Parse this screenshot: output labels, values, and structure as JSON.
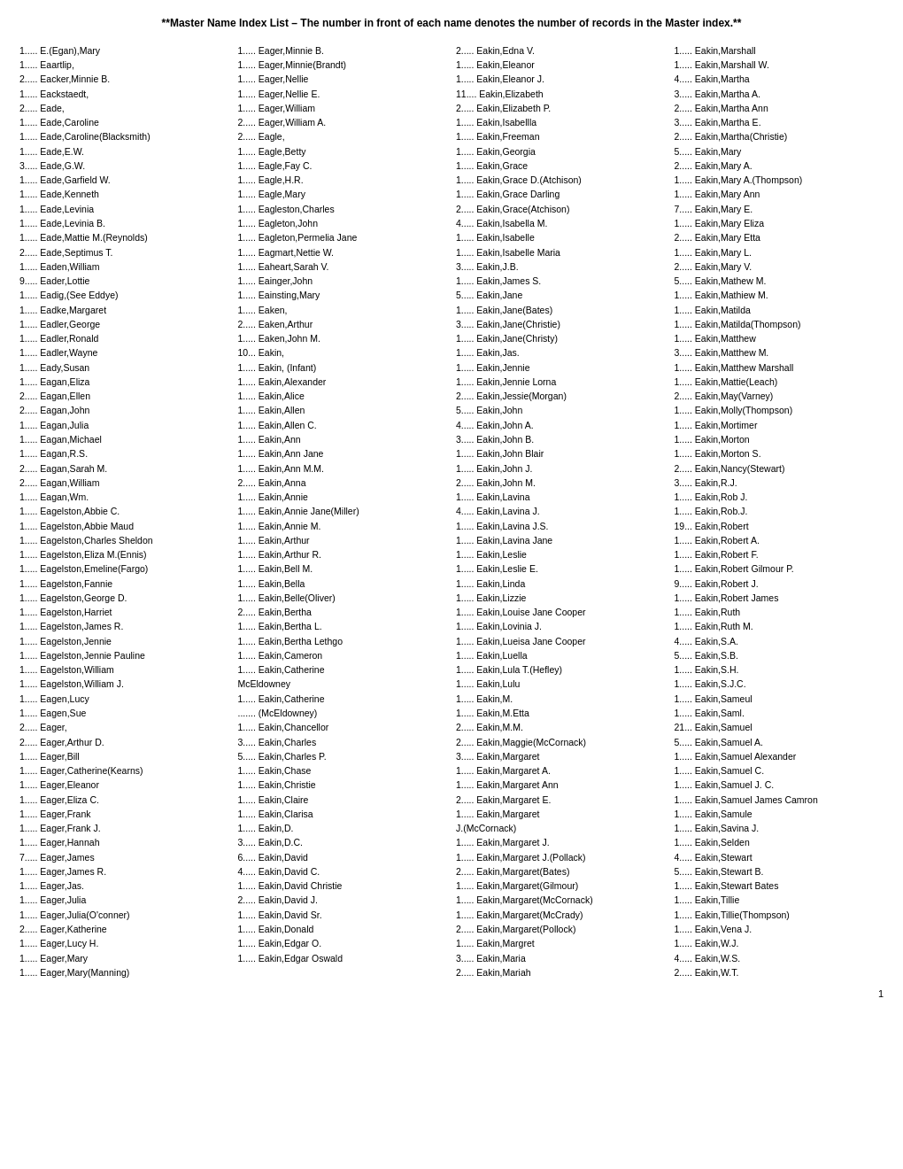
{
  "title": "**Master Name Index List – The number in front of each name denotes the number of records in the Master index.**",
  "page_number": "1",
  "columns": [
    {
      "entries": [
        "1..... E.(Egan),Mary",
        "1..... Eaartlip,",
        "2..... Eacker,Minnie B.",
        "1..... Eackstaedt,",
        "2..... Eade,",
        "1..... Eade,Caroline",
        "1..... Eade,Caroline(Blacksmith)",
        "1..... Eade,E.W.",
        "3..... Eade,G.W.",
        "1..... Eade,Garfield W.",
        "1..... Eade,Kenneth",
        "1..... Eade,Levinia",
        "1..... Eade,Levinia B.",
        "1..... Eade,Mattie M.(Reynolds)",
        "2..... Eade,Septimus T.",
        "1..... Eaden,William",
        "9..... Eader,Lottie",
        "1..... Eadig,(See Eddye)",
        "1..... Eadke,Margaret",
        "1..... Eadler,George",
        "1..... Eadler,Ronald",
        "1..... Eadler,Wayne",
        "1..... Eady,Susan",
        "1..... Eagan,Eliza",
        "2..... Eagan,Ellen",
        "2..... Eagan,John",
        "1..... Eagan,Julia",
        "1..... Eagan,Michael",
        "1..... Eagan,R.S.",
        "2..... Eagan,Sarah M.",
        "2..... Eagan,William",
        "1..... Eagan,Wm.",
        "1..... Eagelston,Abbie C.",
        "1..... Eagelston,Abbie Maud",
        "1..... Eagelston,Charles Sheldon",
        "1..... Eagelston,Eliza M.(Ennis)",
        "1..... Eagelston,Emeline(Fargo)",
        "1..... Eagelston,Fannie",
        "1..... Eagelston,George D.",
        "1..... Eagelston,Harriet",
        "1..... Eagelston,James R.",
        "1..... Eagelston,Jennie",
        "1..... Eagelston,Jennie Pauline",
        "1..... Eagelston,William",
        "1..... Eagelston,William J.",
        "1..... Eagen,Lucy",
        "1..... Eagen,Sue",
        "2..... Eager,",
        "2..... Eager,Arthur D.",
        "1..... Eager,Bill",
        "1..... Eager,Catherine(Kearns)",
        "1..... Eager,Eleanor",
        "1..... Eager,Eliza C.",
        "1..... Eager,Frank",
        "1..... Eager,Frank J.",
        "1..... Eager,Hannah",
        "7..... Eager,James",
        "1..... Eager,James R.",
        "1..... Eager,Jas.",
        "1..... Eager,Julia",
        "1..... Eager,Julia(O'conner)",
        "2..... Eager,Katherine",
        "1..... Eager,Lucy H.",
        "1..... Eager,Mary",
        "1..... Eager,Mary(Manning)"
      ]
    },
    {
      "entries": [
        "1..... Eager,Minnie B.",
        "1..... Eager,Minnie(Brandt)",
        "1..... Eager,Nellie",
        "1..... Eager,Nellie E.",
        "1..... Eager,William",
        "2..... Eager,William A.",
        "2..... Eagle,",
        "1..... Eagle,Betty",
        "1..... Eagle,Fay C.",
        "1..... Eagle,H.R.",
        "1..... Eagle,Mary",
        "1..... Eagleston,Charles",
        "1..... Eagleton,John",
        "1..... Eagleton,Permelia Jane",
        "1..... Eagmart,Nettie W.",
        "1..... Eaheart,Sarah V.",
        "1..... Eainger,John",
        "1..... Eainsting,Mary",
        "1..... Eaken,",
        "2..... Eaken,Arthur",
        "1..... Eaken,John M.",
        "10... Eakin,",
        "1..... Eakin, (Infant)",
        "1..... Eakin,Alexander",
        "1..... Eakin,Alice",
        "1..... Eakin,Allen",
        "1..... Eakin,Allen C.",
        "1..... Eakin,Ann",
        "1..... Eakin,Ann Jane",
        "1..... Eakin,Ann M.M.",
        "2..... Eakin,Anna",
        "1..... Eakin,Annie",
        "1..... Eakin,Annie Jane(Miller)",
        "1..... Eakin,Annie M.",
        "1..... Eakin,Arthur",
        "1..... Eakin,Arthur R.",
        "1..... Eakin,Bell M.",
        "1..... Eakin,Bella",
        "1..... Eakin,Belle(Oliver)",
        "2..... Eakin,Bertha",
        "1..... Eakin,Bertha L.",
        "1..... Eakin,Bertha Lethgo",
        "1..... Eakin,Cameron",
        "1..... Eakin,Catherine",
        "       McEldowney",
        "1..... Eakin,Catherine",
        "....... (McEldowney)",
        "1..... Eakin,Chancellor",
        "3..... Eakin,Charles",
        "5..... Eakin,Charles P.",
        "1..... Eakin,Chase",
        "1..... Eakin,Christie",
        "1..... Eakin,Claire",
        "1..... Eakin,Clarisa",
        "1..... Eakin,D.",
        "3..... Eakin,D.C.",
        "6..... Eakin,David",
        "4..... Eakin,David C.",
        "1..... Eakin,David Christie",
        "2..... Eakin,David J.",
        "1..... Eakin,David Sr.",
        "1..... Eakin,Donald",
        "1..... Eakin,Edgar O.",
        "1..... Eakin,Edgar Oswald"
      ]
    },
    {
      "entries": [
        "2..... Eakin,Edna V.",
        "1..... Eakin,Eleanor",
        "1..... Eakin,Eleanor J.",
        "11.... Eakin,Elizabeth",
        "2..... Eakin,Elizabeth P.",
        "1..... Eakin,Isabellla",
        "1..... Eakin,Freeman",
        "1..... Eakin,Georgia",
        "1..... Eakin,Grace",
        "1..... Eakin,Grace D.(Atchison)",
        "1..... Eakin,Grace Darling",
        "2..... Eakin,Grace(Atchison)",
        "4..... Eakin,Isabella M.",
        "1..... Eakin,Isabelle",
        "1..... Eakin,Isabelle Maria",
        "3..... Eakin,J.B.",
        "1..... Eakin,James S.",
        "5..... Eakin,Jane",
        "1..... Eakin,Jane(Bates)",
        "3..... Eakin,Jane(Christie)",
        "1..... Eakin,Jane(Christy)",
        "1..... Eakin,Jas.",
        "1..... Eakin,Jennie",
        "1..... Eakin,Jennie Lorna",
        "2..... Eakin,Jessie(Morgan)",
        "5..... Eakin,John",
        "4..... Eakin,John A.",
        "3..... Eakin,John B.",
        "1..... Eakin,John Blair",
        "1..... Eakin,John J.",
        "2..... Eakin,John M.",
        "1..... Eakin,Lavina",
        "4..... Eakin,Lavina J.",
        "1..... Eakin,Lavina J.S.",
        "1..... Eakin,Lavina Jane",
        "1..... Eakin,Leslie",
        "1..... Eakin,Leslie E.",
        "1..... Eakin,Linda",
        "1..... Eakin,Lizzie",
        "1..... Eakin,Louise Jane Cooper",
        "1..... Eakin,Lovinia J.",
        "1..... Eakin,Lueisa Jane Cooper",
        "1..... Eakin,Luella",
        "1..... Eakin,Lula T.(Hefley)",
        "1..... Eakin,Lulu",
        "1..... Eakin,M.",
        "1..... Eakin,M.Etta",
        "2..... Eakin,M.M.",
        "2..... Eakin,Maggie(McCornack)",
        "3..... Eakin,Margaret",
        "1..... Eakin,Margaret A.",
        "1..... Eakin,Margaret Ann",
        "2..... Eakin,Margaret E.",
        "1..... Eakin,Margaret",
        "       J.(McCornack)",
        "1..... Eakin,Margaret J.",
        "1..... Eakin,Margaret J.(Pollack)",
        "2..... Eakin,Margaret(Bates)",
        "1..... Eakin,Margaret(Gilmour)",
        "1..... Eakin,Margaret(McCornack)",
        "1..... Eakin,Margaret(McCrady)",
        "2..... Eakin,Margaret(Pollock)",
        "1..... Eakin,Margret",
        "3..... Eakin,Maria",
        "2..... Eakin,Mariah"
      ]
    },
    {
      "entries": [
        "1..... Eakin,Marshall",
        "1..... Eakin,Marshall W.",
        "4..... Eakin,Martha",
        "3..... Eakin,Martha A.",
        "2..... Eakin,Martha Ann",
        "3..... Eakin,Martha E.",
        "2..... Eakin,Martha(Christie)",
        "5..... Eakin,Mary",
        "2..... Eakin,Mary A.",
        "1..... Eakin,Mary A.(Thompson)",
        "1..... Eakin,Mary Ann",
        "7..... Eakin,Mary E.",
        "1..... Eakin,Mary Eliza",
        "2..... Eakin,Mary Etta",
        "1..... Eakin,Mary L.",
        "2..... Eakin,Mary V.",
        "5..... Eakin,Mathew M.",
        "1..... Eakin,Mathiew M.",
        "1..... Eakin,Matilda",
        "1..... Eakin,Matilda(Thompson)",
        "1..... Eakin,Matthew",
        "3..... Eakin,Matthew M.",
        "1..... Eakin,Matthew Marshall",
        "1..... Eakin,Mattie(Leach)",
        "2..... Eakin,May(Varney)",
        "1..... Eakin,Molly(Thompson)",
        "1..... Eakin,Mortimer",
        "1..... Eakin,Morton",
        "1..... Eakin,Morton S.",
        "2..... Eakin,Nancy(Stewart)",
        "3..... Eakin,R.J.",
        "1..... Eakin,Rob J.",
        "1..... Eakin,Rob.J.",
        "19... Eakin,Robert",
        "1..... Eakin,Robert A.",
        "1..... Eakin,Robert F.",
        "1..... Eakin,Robert Gilmour P.",
        "9..... Eakin,Robert J.",
        "1..... Eakin,Robert James",
        "1..... Eakin,Ruth",
        "1..... Eakin,Ruth M.",
        "4..... Eakin,S.A.",
        "5..... Eakin,S.B.",
        "1..... Eakin,S.H.",
        "1..... Eakin,S.J.C.",
        "1..... Eakin,Sameul",
        "1..... Eakin,Saml.",
        "21... Eakin,Samuel",
        "5..... Eakin,Samuel A.",
        "1..... Eakin,Samuel Alexander",
        "1..... Eakin,Samuel C.",
        "1..... Eakin,Samuel J. C.",
        "1..... Eakin,Samuel James Camron",
        "1..... Eakin,Samule",
        "1..... Eakin,Savina J.",
        "1..... Eakin,Selden",
        "4..... Eakin,Stewart",
        "5..... Eakin,Stewart B.",
        "1..... Eakin,Stewart Bates",
        "1..... Eakin,Tillie",
        "1..... Eakin,Tillie(Thompson)",
        "1..... Eakin,Vena J.",
        "1..... Eakin,W.J.",
        "4..... Eakin,W.S.",
        "2..... Eakin,W.T."
      ]
    }
  ]
}
